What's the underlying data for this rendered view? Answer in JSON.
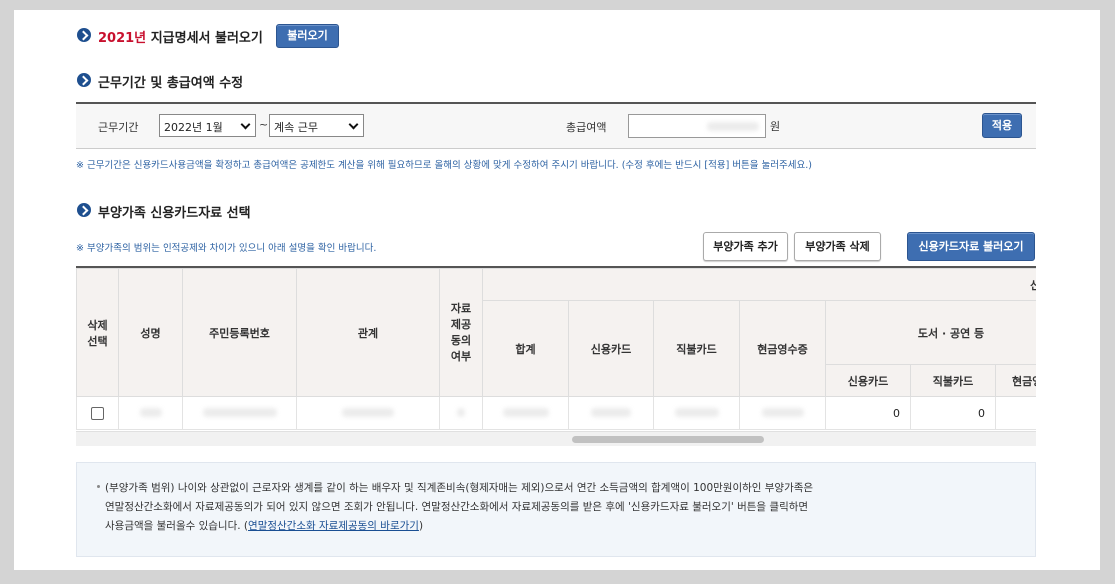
{
  "section1": {
    "year": "2021년",
    "title_rest": "지급명세서 불러오기",
    "button": "불러오기"
  },
  "section2": {
    "title": "근무기간 및 총급여액 수정",
    "period_label": "근무기간",
    "start_select": "2022년 1월",
    "tilde": "~",
    "end_select": "계속 근무",
    "salary_label": "총급여액",
    "unit": "원",
    "apply_button": "적용",
    "notice": "※ 근무기간은 신용카드사용금액을 확정하고 총급여액은 공제한도 계산을 위해 필요하므로 올해의 상황에 맞게 수정하여 주시기 바랍니다. (수정 후에는 반드시 [적용] 버튼을 눌러주세요.)"
  },
  "section3": {
    "title": "부양가족 신용카드자료 선택",
    "notice": "※ 부양가족의 범위는 인적공제와 차이가 있으니 아래 설명을 확인 바랍니다.",
    "add_button": "부양가족 추가",
    "delete_button": "부양가족 삭제",
    "load_button": "신용카드자료 불러오기",
    "table": {
      "headers": {
        "select": "삭제\n선택",
        "name": "성명",
        "rrn": "주민등록번호",
        "relation": "관계",
        "consent": "자료\n제공\n동의\n여부",
        "top_group": "신",
        "total": "합계",
        "credit": "신용카드",
        "debit": "직불카드",
        "cash": "현금영수증",
        "books_group": "도서 · 공연 등",
        "books_credit": "신용카드",
        "books_debit": "직불카드",
        "books_cash": "현금영"
      },
      "row": {
        "books_credit": "0",
        "books_debit": "0"
      }
    },
    "info": {
      "line1": "(부양가족 범위) 나이와 상관없이 근로자와 생계를 같이 하는 배우자 및 직계존비속(형제자매는 제외)으로서 연간 소득금액의 합계액이 100만원이하인 부양가족은",
      "line2": "연말정산간소화에서 자료제공동의가 되어 있지 않으면 조회가 안됩니다. 연말정산간소화에서 자료제공동의를 받은 후에 '신용카드자료 불러오기' 버튼을 클릭하면",
      "line3_prefix": "사용금액을 불러올수 있습니다. (",
      "line3_link": "연말정산간소화 자료제공동의 바로가기",
      "line3_suffix": ")"
    }
  }
}
